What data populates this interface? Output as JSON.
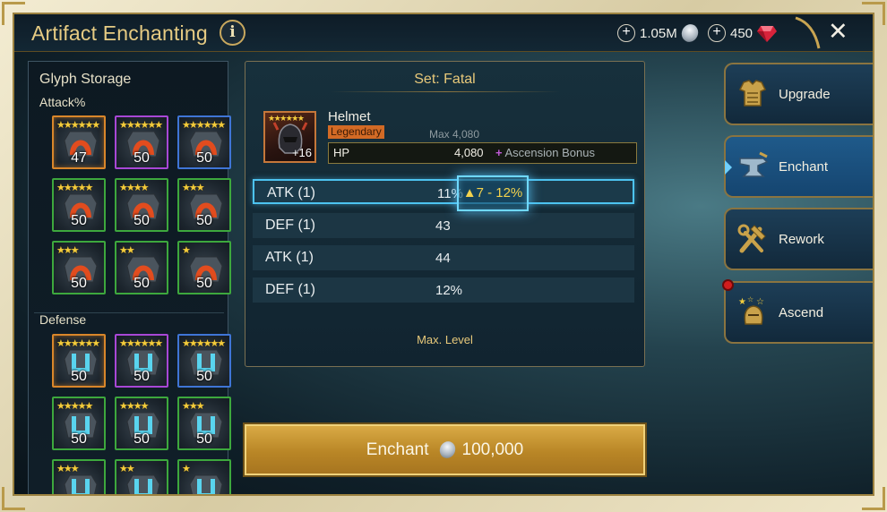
{
  "header": {
    "title": "Artifact Enchanting",
    "info_icon": "info-icon",
    "silver_amount": "1.05M",
    "gems_amount": "450",
    "close_icon": "close-icon"
  },
  "glyph_storage": {
    "title": "Glyph Storage",
    "sections": [
      {
        "label": "Attack%",
        "glyphs": [
          {
            "count": "47",
            "stars": 6,
            "rarity": "legendary",
            "selected": true
          },
          {
            "count": "50",
            "stars": 6,
            "rarity": "epic"
          },
          {
            "count": "50",
            "stars": 6,
            "rarity": "rare"
          },
          {
            "count": "50",
            "stars": 5,
            "rarity": "uncommon"
          },
          {
            "count": "50",
            "stars": 4,
            "rarity": "uncommon"
          },
          {
            "count": "50",
            "stars": 3,
            "rarity": "uncommon"
          },
          {
            "count": "50",
            "stars": 3,
            "rarity": "uncommon"
          },
          {
            "count": "50",
            "stars": 2,
            "rarity": "uncommon"
          },
          {
            "count": "50",
            "stars": 1,
            "rarity": "uncommon"
          }
        ]
      },
      {
        "label": "Defense",
        "glyphs": [
          {
            "count": "50",
            "stars": 6,
            "rarity": "legendary"
          },
          {
            "count": "50",
            "stars": 6,
            "rarity": "epic"
          },
          {
            "count": "50",
            "stars": 6,
            "rarity": "rare"
          },
          {
            "count": "50",
            "stars": 5,
            "rarity": "uncommon"
          },
          {
            "count": "50",
            "stars": 4,
            "rarity": "uncommon"
          },
          {
            "count": "50",
            "stars": 3,
            "rarity": "uncommon"
          },
          {
            "count": "",
            "stars": 3,
            "rarity": "uncommon"
          },
          {
            "count": "",
            "stars": 2,
            "rarity": "uncommon"
          },
          {
            "count": "",
            "stars": 1,
            "rarity": "uncommon"
          }
        ]
      }
    ]
  },
  "artifact": {
    "set": "Set: Fatal",
    "name": "Helmet",
    "rarity": "Legendary",
    "level": "+16",
    "max_value": "Max 4,080",
    "main_stat": {
      "label": "HP",
      "value": "4,080",
      "ascension": "Ascension Bonus"
    },
    "substats": [
      {
        "name": "ATK",
        "rolls": "(1)",
        "value": "11%",
        "selected": true
      },
      {
        "name": "DEF",
        "rolls": "(1)",
        "value": "43"
      },
      {
        "name": "ATK",
        "rolls": "(1)",
        "value": "44"
      },
      {
        "name": "DEF",
        "rolls": "(1)",
        "value": "12%"
      }
    ],
    "enchant_range": "▲7 - 12%",
    "max_level_note": "Max. Level"
  },
  "enchant_button": {
    "label": "Enchant",
    "cost": "100,000"
  },
  "tabs": [
    {
      "label": "Upgrade",
      "icon": "armor-icon"
    },
    {
      "label": "Enchant",
      "icon": "anvil-icon",
      "active": true
    },
    {
      "label": "Rework",
      "icon": "tools-icon"
    },
    {
      "label": "Ascend",
      "icon": "helmet-stars-icon",
      "notification": true
    }
  ],
  "colors": {
    "gold_text": "#e8c97a",
    "legendary": "#d9862a",
    "epic": "#a847d6",
    "rare": "#3f75d6",
    "uncommon": "#3da83d",
    "selection_glow": "#4dc3f0",
    "enchant_button": "#c89633"
  }
}
